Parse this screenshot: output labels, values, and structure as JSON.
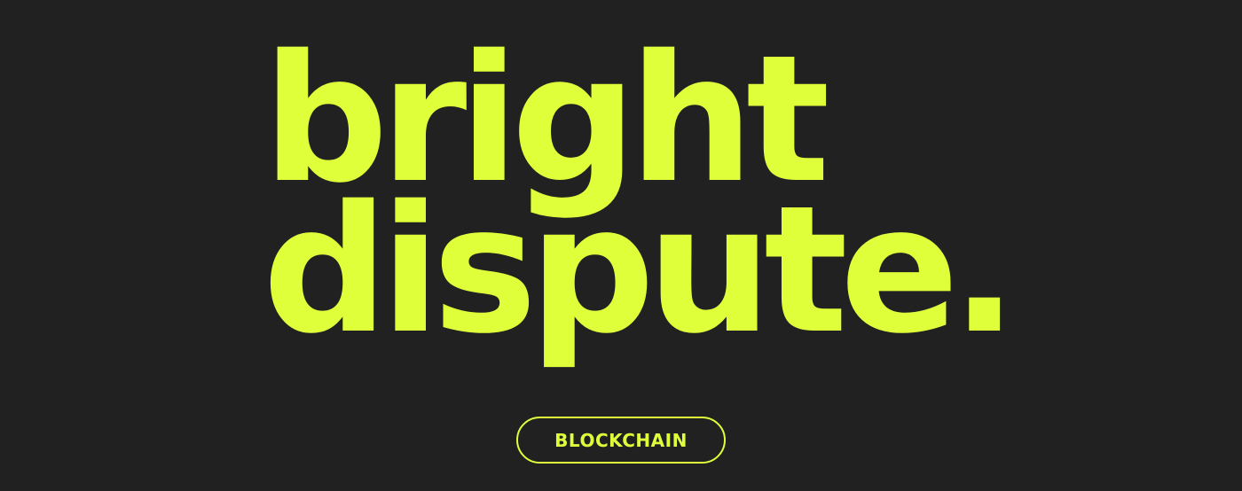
{
  "headline": {
    "line1": "bright",
    "line2": "dispute."
  },
  "tag": {
    "label": "BLOCKCHAIN"
  },
  "colors": {
    "background": "#212121",
    "accent": "#DFFF3A"
  }
}
